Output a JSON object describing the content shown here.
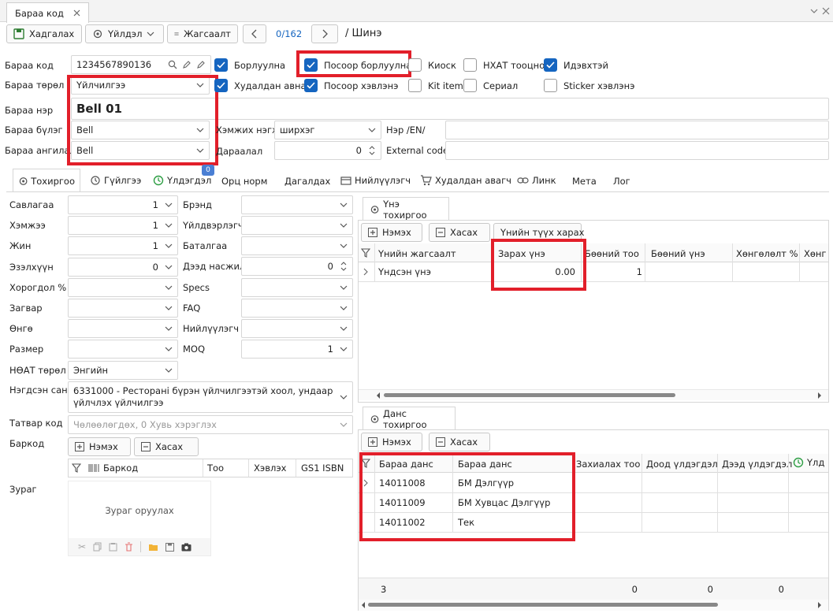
{
  "window": {
    "tab_title": "Бараа код"
  },
  "toolbar": {
    "save": "Хадгалах",
    "action": "Үйлдэл",
    "list": "Жагсаалт",
    "counter": "0/162",
    "breadcrumb": "/ Шинэ"
  },
  "header": {
    "code_label": "Бараа код",
    "code_value": "1234567890136",
    "type_label": "Бараа төрөл",
    "type_value": "Үйлчилгээ",
    "name_label": "Бараа нэр",
    "name_value": "Bell 01",
    "group_label": "Бараа бүлэг",
    "group_value": "Bell",
    "class_label": "Бараа ангилал",
    "class_value": "Bell",
    "unit_label": "Хэмжих нэгж",
    "unit_value": "ширхэг",
    "order_label": "Дараалал",
    "order_value": "0",
    "name_en_label": "Нэр /EN/",
    "ext_code_label": "External code"
  },
  "checks": {
    "sell": "Борлуулна",
    "sell_pos": "Посоор борлуулна",
    "kiosk": "Киоск",
    "vat_calc": "НХАТ тооцно",
    "active": "Идэвхтэй",
    "buy": "Худалдан авна",
    "pos_print": "Посоор хэвлэнэ",
    "kit": "Kit item",
    "serial": "Сериал",
    "sticker": "Sticker хэвлэнэ"
  },
  "tabs": [
    "Тохиргоо",
    "Гүйлгээ",
    "Үлдэгдэл",
    "Орц норм",
    "Дагалдах",
    "Нийлүүлэгч",
    "Худалдан авагч",
    "Линк",
    "Мета",
    "Лог"
  ],
  "tab_badge": "0",
  "left_form": {
    "packaging": "Савлагаа",
    "packaging_v": "1",
    "size": "Хэмжээ",
    "size_v": "1",
    "weight": "Жин",
    "weight_v": "1",
    "volume": "Эзэлхүүн",
    "volume_v": "0",
    "discount": "Хорогдол %",
    "model": "Загвар",
    "color": "Өнгө",
    "sizing": "Размер",
    "vat_type": "НӨАТ төрөл",
    "vat_type_v": "Энгийн",
    "class_code": "Нэгдсэн сан",
    "class_code_v": "6331000 - Ресторанi бүрэн үйлчилгээтэй хоол, ундаар үйлчлэх үйлчилгээ",
    "tax_code": "Татвар код",
    "tax_code_ph": "Чөлөөлөгдөх, 0 Хувь хэрэглэх",
    "barcode": "Баркод",
    "image": "Зураг",
    "brand": "Брэнд",
    "manufacturer": "Үйлдвэрлэгч",
    "warranty": "Баталгаа",
    "max_life": "Дээд насжилт",
    "max_life_v": "0",
    "specs": "Specs",
    "faq": "FAQ",
    "supplier": "Нийлүүлэгч",
    "moq": "MOQ",
    "moq_v": "1"
  },
  "barcode_grid": {
    "add": "Нэмэх",
    "remove": "Хасах",
    "cols": [
      "Баркод",
      "Тоо",
      "Хэвлэх",
      "GS1 ISBN"
    ]
  },
  "image_box": {
    "upload": "Зураг оруулах"
  },
  "price_panel": {
    "tab": "Үнэ тохиргоо",
    "add": "Нэмэх",
    "remove": "Хасах",
    "history": "Үнийн түүх харах",
    "cols": [
      "Үнийн жагсаалт",
      "Зарах үнэ",
      "Бөөний тоо",
      "Бөөний үнэ",
      "Хөнгөлөлт %",
      "Хөнг"
    ],
    "row": {
      "list": "Үндсэн үнэ",
      "price": "0.00",
      "wholesale_qty": "1"
    }
  },
  "account_panel": {
    "tab": "Данс тохиргоо",
    "add": "Нэмэх",
    "remove": "Хасах",
    "cols": [
      "Бараа данс",
      "Бараа данс",
      "Захиалах тоо",
      "Доод үлдэгдэл",
      "Дээд үлдэгдэл",
      "Үлд"
    ],
    "rows": [
      {
        "code": "14011008",
        "name": "БМ Дэлгүүр"
      },
      {
        "code": "14011009",
        "name": "БМ Хувцас Дэлгүүр"
      },
      {
        "code": "14011002",
        "name": "Тек"
      }
    ],
    "footer": {
      "count": "3",
      "sum1": "0",
      "sum2": "0",
      "sum3": "0"
    }
  }
}
